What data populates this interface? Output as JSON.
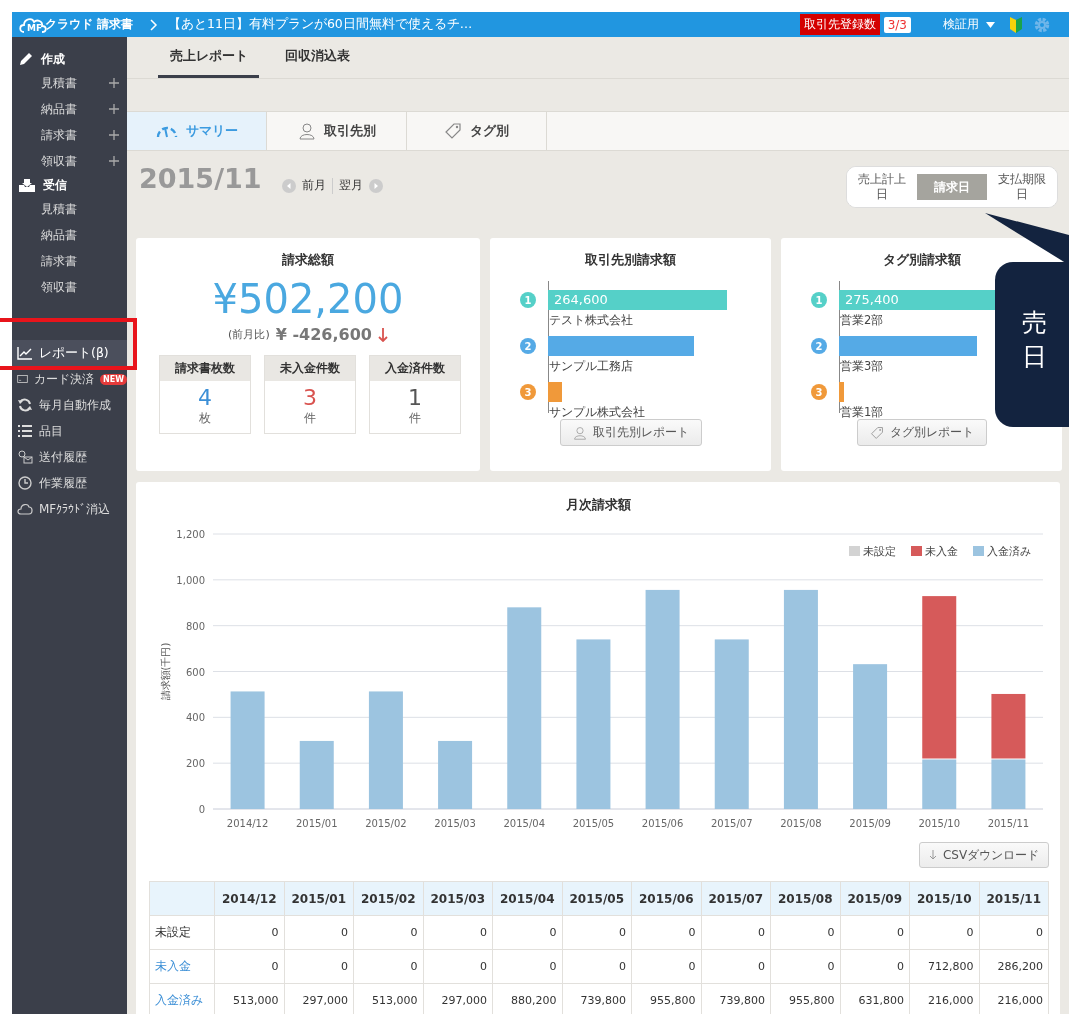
{
  "header": {
    "logo_mark": "MF",
    "app_name": "クラウド 請求書",
    "notice": "【あと11日】有料プランが60日間無料で使えるチ…",
    "partner_badge": {
      "label": "取引先登録数",
      "count": "3/3"
    },
    "user": "検証用"
  },
  "sidebar": {
    "sections": [
      {
        "title": "作成",
        "items": [
          {
            "label": "見積書",
            "add": true
          },
          {
            "label": "納品書",
            "add": true
          },
          {
            "label": "請求書",
            "add": true
          },
          {
            "label": "領収書",
            "add": true
          }
        ]
      },
      {
        "title": "受信",
        "items": [
          {
            "label": "見積書",
            "add": false
          },
          {
            "label": "納品書",
            "add": false
          },
          {
            "label": "請求書",
            "add": false
          },
          {
            "label": "領収書",
            "add": false
          }
        ]
      }
    ],
    "nav": [
      {
        "label": "レポート(β)",
        "selected": true
      },
      {
        "label": "カード決済",
        "badge": "NEW",
        "selected": false
      },
      {
        "label": "毎月自動作成",
        "selected": false
      },
      {
        "label": "品目",
        "selected": false
      },
      {
        "label": "送付履歴",
        "selected": false
      },
      {
        "label": "作業履歴",
        "selected": false
      },
      {
        "label": "MFｸﾗｳﾄﾞ消込",
        "selected": false
      }
    ]
  },
  "tabs": [
    {
      "label": "売上レポート",
      "selected": true
    },
    {
      "label": "回収消込表",
      "selected": false
    }
  ],
  "subtabs": [
    {
      "label": "サマリー",
      "selected": true
    },
    {
      "label": "取引先別",
      "selected": false
    },
    {
      "label": "タグ別",
      "selected": false
    }
  ],
  "period": {
    "month": "2015/11",
    "prev": "前月",
    "next": "翌月"
  },
  "date_basis": [
    {
      "label": "売上計上日",
      "selected": false
    },
    {
      "label": "請求日",
      "selected": true
    },
    {
      "label": "支払期限日",
      "selected": false
    }
  ],
  "callout": {
    "lines": [
      "売",
      "日"
    ]
  },
  "summary": {
    "title": "請求総額",
    "amount": "¥502,200",
    "compare_label": "(前月比)",
    "compare_value": "¥ -426,600",
    "stats": [
      {
        "label": "請求書枚数",
        "value": "4",
        "unit": "枚",
        "color": "#3c8fd6"
      },
      {
        "label": "未入金件数",
        "value": "3",
        "unit": "件",
        "color": "#d9534f"
      },
      {
        "label": "入金済件数",
        "value": "1",
        "unit": "件",
        "color": "#555555"
      }
    ]
  },
  "rankings": [
    {
      "title": "取引先別請求額",
      "button": "取引先別レポート",
      "entries": [
        {
          "rank": "1",
          "name": "テスト株式会社",
          "value": "264,600",
          "color": "#55d0c8"
        },
        {
          "rank": "2",
          "name": "サンプル工務店",
          "color": "#55aae6"
        },
        {
          "rank": "3",
          "name": "サンプル株式会社",
          "color": "#f0993a"
        }
      ]
    },
    {
      "title": "タグ別請求額",
      "button": "タグ別レポート",
      "entries": [
        {
          "rank": "1",
          "name": "営業2部",
          "value": "275,400",
          "color": "#55d0c8"
        },
        {
          "rank": "2",
          "name": "営業3部",
          "color": "#55aae6"
        },
        {
          "rank": "3",
          "name": "営業1部",
          "color": "#f0993a"
        }
      ]
    }
  ],
  "monthly": {
    "title": "月次請求額",
    "chart_data": {
      "type": "bar",
      "stacked": true,
      "grid": true,
      "legend": true,
      "ylabel": "請求額(千円)",
      "categories": [
        "2014/12",
        "2015/01",
        "2015/02",
        "2015/03",
        "2015/04",
        "2015/05",
        "2015/06",
        "2015/07",
        "2015/08",
        "2015/09",
        "2015/10",
        "2015/11"
      ],
      "series": [
        {
          "name": "未設定",
          "color": "#d3d3d3",
          "values": [
            0,
            0,
            0,
            0,
            0,
            0,
            0,
            0,
            0,
            0,
            0,
            0
          ]
        },
        {
          "name": "未入金",
          "color": "#d65a5a",
          "values": [
            0,
            0,
            0,
            0,
            0,
            0,
            0,
            0,
            0,
            0,
            713,
            286
          ]
        },
        {
          "name": "入金済み",
          "color": "#9cc4e0",
          "values": [
            513,
            297,
            513,
            297,
            880,
            740,
            956,
            740,
            956,
            632,
            216,
            216
          ]
        }
      ],
      "ylim": [
        0,
        1200
      ],
      "yticks": [
        {
          "value": 0,
          "label": "0"
        },
        {
          "value": 200,
          "label": "200"
        },
        {
          "value": 400,
          "label": "400"
        },
        {
          "value": 600,
          "label": "600"
        },
        {
          "value": 800,
          "label": "800"
        },
        {
          "value": 1000,
          "label": "1,000"
        },
        {
          "value": 1200,
          "label": "1,200"
        }
      ]
    },
    "csv_button": "CSVダウンロード",
    "table": {
      "columns": [
        "2014/12",
        "2015/01",
        "2015/02",
        "2015/03",
        "2015/04",
        "2015/05",
        "2015/06",
        "2015/07",
        "2015/08",
        "2015/09",
        "2015/10",
        "2015/11"
      ],
      "rows": [
        {
          "label": "未設定",
          "kind": "plain",
          "cells": [
            "0",
            "0",
            "0",
            "0",
            "0",
            "0",
            "0",
            "0",
            "0",
            "0",
            "0",
            "0"
          ]
        },
        {
          "label": "未入金",
          "kind": "link",
          "cells": [
            "0",
            "0",
            "0",
            "0",
            "0",
            "0",
            "0",
            "0",
            "0",
            "0",
            "712,800",
            "286,200"
          ]
        },
        {
          "label": "入金済み",
          "kind": "link",
          "cells": [
            "513,000",
            "297,000",
            "513,000",
            "297,000",
            "880,200",
            "739,800",
            "955,800",
            "739,800",
            "955,800",
            "631,800",
            "216,000",
            "216,000"
          ]
        }
      ]
    }
  }
}
